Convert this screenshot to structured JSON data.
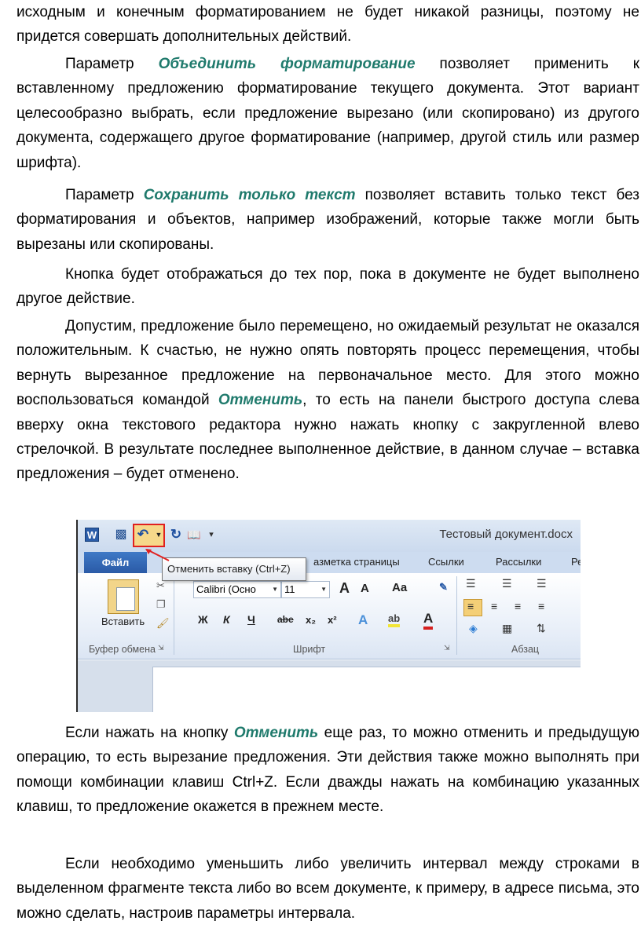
{
  "paragraphs": {
    "p1": "исходным и конечным форматированием не будет никакой разницы, поэтому не придется совершать дополнительных действий.",
    "p2_before": "Параметр ",
    "p2_kw": "Объединить форматирование",
    "p2_after": " позволяет применить к вставленному предложению форматирование текущего документа. Этот вариант целесообразно выбрать, если предложение вырезано (или скопировано) из другого документа, содержащего другое форматирование (например, другой стиль или размер шрифта).",
    "p3_before": "Параметр ",
    "p3_kw": "Сохранить только текст",
    "p3_after": " позволяет вставить только текст без форматирования и объектов, например изображений, которые также могли быть вырезаны или скопированы.",
    "p4": "Кнопка будет отображаться до тех пор, пока в документе не будет выполнено другое действие.",
    "p5_before": "Допустим, предложение было перемещено, но ожидаемый результат не оказался положительным. К счастью, не нужно опять повторять процесс перемещения, чтобы вернуть вырезанное предложение на первоначальное место. Для этого можно воспользоваться командой ",
    "p5_kw": "Отменить",
    "p5_after": ", то есть на панели быстрого доступа слева вверху окна текстового редактора нужно нажать кнопку с закругленной влево стрелочкой. В результате последнее выполненное действие, в данном случае – вставка предложения – будет отменено.",
    "p6_before": "Если нажать на кнопку ",
    "p6_kw": "Отменить",
    "p6_after": " еще раз, то можно отменить и предыдущую операцию, то есть вырезание предложения. Эти действия также можно выполнять при помощи комбинации клавиш Ctrl+Z. Если дважды нажать на комбинацию указанных клавиш, то предложение окажется в прежнем месте.",
    "p7": "Если необходимо уменьшить либо увеличить интервал между строками в выделенном фрагменте текста либо во всем документе, к примеру, в адресе письма, это можно сделать, настроив параметры интервала."
  },
  "screenshot": {
    "window_title": "Тестовый документ.docx",
    "word_logo": "W",
    "tooltip": "Отменить вставку (Ctrl+Z)",
    "tabs": {
      "file": "Файл",
      "layout": "азметка страницы",
      "refs": "Ссылки",
      "mailings": "Рассылки",
      "review": "Ре"
    },
    "clipboard": {
      "paste": "Вставить",
      "group": "Буфер обмена"
    },
    "font": {
      "name": "Calibri (Осно",
      "size": "11",
      "bold": "Ж",
      "italic": "К",
      "underline": "Ч",
      "strike": "abe",
      "sub": "x₂",
      "sup": "x²",
      "grow": "A",
      "shrink": "A",
      "case": "Aa",
      "group": "Шрифт"
    },
    "paragraph": {
      "group": "Абзац"
    }
  },
  "colors": {
    "keyword": "#1f7a6c",
    "highlight_box": "#e02020"
  }
}
